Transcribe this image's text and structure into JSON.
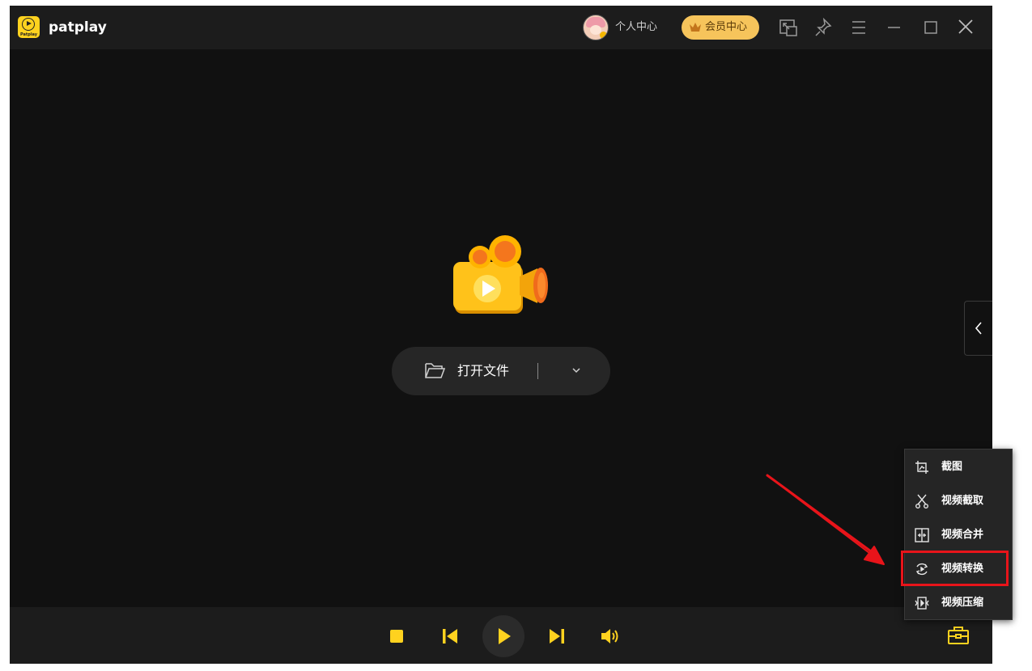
{
  "app": {
    "name": "patplay",
    "logo_text": "Patplay"
  },
  "header": {
    "personal_center": "个人中心",
    "vip_center": "会员中心"
  },
  "header_icons": [
    "mini-mode-icon",
    "pin-icon",
    "menu-icon",
    "minimize-icon",
    "maximize-icon",
    "close-icon"
  ],
  "stage": {
    "open_file": "打开文件"
  },
  "tools_menu": {
    "items": [
      {
        "label": "截图",
        "icon": "screenshot-icon"
      },
      {
        "label": "视频截取",
        "icon": "scissors-icon"
      },
      {
        "label": "视频合并",
        "icon": "merge-icon"
      },
      {
        "label": "视频转换",
        "icon": "convert-icon",
        "highlighted": true
      },
      {
        "label": "视频压缩",
        "icon": "compress-icon"
      }
    ]
  },
  "controls": [
    "stop-icon",
    "previous-icon",
    "play-icon",
    "next-icon",
    "volume-icon",
    "toolbox-icon"
  ],
  "colors": {
    "accent": "#FFD21F",
    "background": "#111111",
    "bar": "#1C1C1C",
    "vip": "#F6C45B",
    "highlight": "#E8141A"
  }
}
